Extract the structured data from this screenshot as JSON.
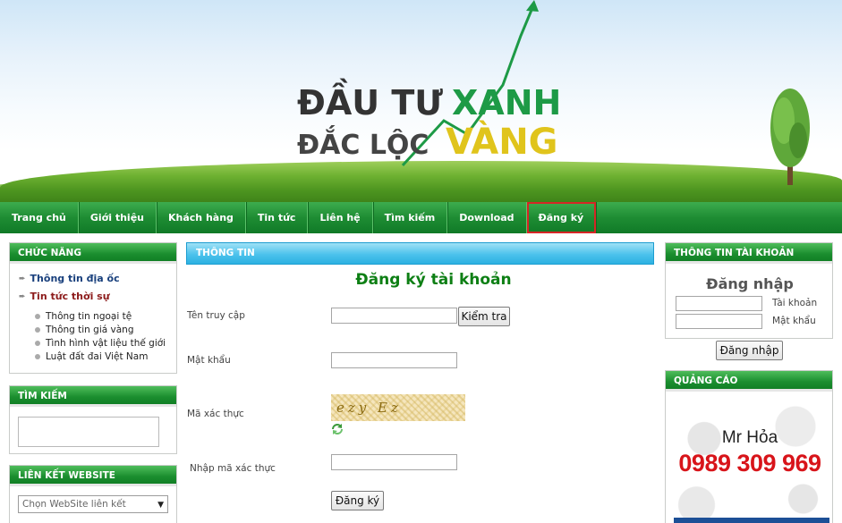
{
  "header": {
    "logo_line1_part1": "ĐẦU TƯ",
    "logo_line1_part2": "XANH",
    "logo_line2_part1": "ĐẮC LỘC",
    "logo_line2_part2": "VÀNG"
  },
  "nav": {
    "items": [
      "Trang chủ",
      "Giới thiệu",
      "Khách hàng",
      "Tin tức",
      "Liên hệ",
      "Tìm kiếm",
      "Download",
      "Đăng ký"
    ],
    "active_index": 7
  },
  "left": {
    "functions": {
      "title": "CHỨC NĂNG",
      "main_items": [
        "Thông tin địa ốc",
        "Tin tức thời sự"
      ],
      "sub_items": [
        "Thông tin ngoại tệ",
        "Thông tin giá vàng",
        "Tình hình vật liệu thế giới",
        "Luật đất đai Việt Nam"
      ]
    },
    "search": {
      "title": "TÌM KIẾM"
    },
    "links": {
      "title": "LIÊN KẾT WEBSITE",
      "select_value": "Chọn WebSite liên kết"
    }
  },
  "center": {
    "header": "THÔNG TIN",
    "title": "Đăng ký tài khoản",
    "username_label": "Tên truy cập",
    "check_button": "Kiểm tra",
    "password_label": "Mật khẩu",
    "captcha_label": "Mã xác thực",
    "captcha_text": "ezy Ez",
    "captcha_input_label": "Nhập mã xác thực",
    "submit_button": "Đăng ký"
  },
  "right": {
    "account": {
      "title": "THÔNG TIN TÀI KHOẢN",
      "login_title": "Đăng nhập",
      "username_label": "Tài khoản",
      "password_label": "Mật khẩu",
      "login_button": "Đăng nhập"
    },
    "ads": {
      "title": "QUẢNG CÁO",
      "name": "Mr Hỏa",
      "phone": "0989 309 969"
    }
  },
  "colors": {
    "nav_green": "#1e8c33",
    "title_green": "#0d7f14",
    "info_blue": "#2cb1e2",
    "active_outline": "#d62626",
    "phone_red": "#d8141a"
  }
}
